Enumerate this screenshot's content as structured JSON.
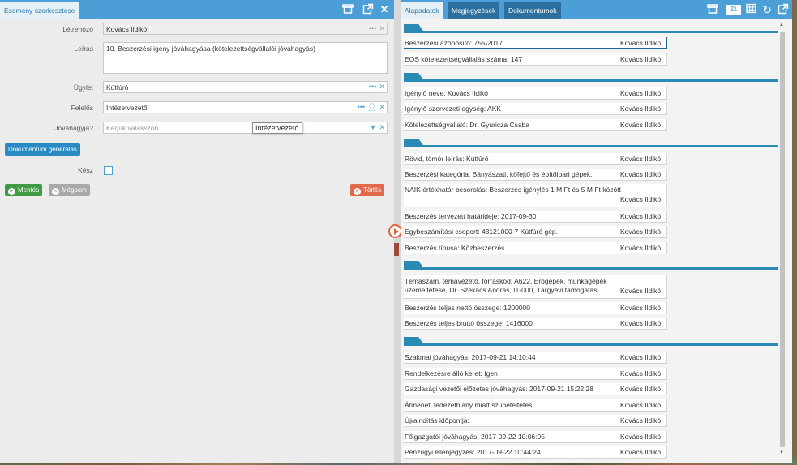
{
  "left_pane": {
    "tab_title": "Esemény szerkesztése",
    "fields": {
      "creator": {
        "label": "Létrehozó",
        "value": "Kovács Ildikó"
      },
      "description": {
        "label": "Leírás",
        "value": "10. Beszerzési igény jóváhagyása (kötelezettségvállalói jóváhagyás)"
      },
      "case": {
        "label": "Ügylet",
        "value": "Kútfúró"
      },
      "responsible": {
        "label": "Felelős",
        "value": "Intézetvezető"
      },
      "approver": {
        "label": "Jóváhagyja?",
        "placeholder": "Kérjük válasszon..."
      },
      "done": {
        "label": "Kész"
      }
    },
    "tooltip": "Intézetvezető",
    "buttons": {
      "generate": "Dokumentum generálás",
      "save": "Mentés",
      "cancel": "Mégsem",
      "delete": "Törlés"
    }
  },
  "right_pane": {
    "tabs": [
      "Alapadatok",
      "Megjegyzések",
      "Dokumentumok"
    ],
    "badge": "21",
    "owner": "Kovács Ildikó",
    "sections": [
      {
        "rows": [
          {
            "text": "Beszerzési azonosító: 755\\2017",
            "owner": "Kovács Ildikó"
          },
          {
            "text": "EOS kötelezettségvállalás száma: 147",
            "owner": "Kovács Ildikó"
          }
        ]
      },
      {
        "rows": [
          {
            "text": "Igénylő neve: Kovács Ildikó",
            "owner": "Kovács Ildikó"
          },
          {
            "text": "Igénylő szervezeti egység: AKK",
            "owner": "Kovács Ildikó"
          },
          {
            "text": "Kötelezettségvállaló: Dr. Gyuricza Csaba",
            "owner": "Kovács Ildikó"
          }
        ]
      },
      {
        "rows": [
          {
            "text": "Rövid, tömör leírás: Kútfúró",
            "owner": "Kovács Ildikó"
          },
          {
            "text": "Beszerzési kategória: Bányászati, kőfejtő és építőipari gépek.",
            "owner": "Kovács Ildikó"
          },
          {
            "text": "NAIK értékhatár besorolás: Beszerzés igénylés 1 M Ft és 5 M Ft között",
            "owner": "Kovács Ildikó"
          },
          {
            "text": "Beszerzés tervezett határideje: 2017-09-30",
            "owner": "Kovács Ildikó"
          },
          {
            "text": "Egybeszámítási csoport: 43121000-7 Kútfúró gép.",
            "owner": "Kovács Ildikó"
          },
          {
            "text": "Beszerzés típusa: Közbeszerzés",
            "owner": "Kovács Ildikó"
          }
        ]
      },
      {
        "rows": [
          {
            "text": "Témaszám, témavezető, forráskód: A622, Erőgépek, munkagépek üzemeltetése, Dr. Székács András, IT-000, Tárgyévi támogatás",
            "owner": "Kovács Ildikó"
          },
          {
            "text": "Beszerzés teljes nettó összege: 1200000",
            "owner": "Kovács Ildikó"
          },
          {
            "text": "Beszerzés teljes bruttó összege: 1416000",
            "owner": "Kovács Ildikó"
          }
        ]
      },
      {
        "rows": [
          {
            "text": "Szakmai jóváhagyás: 2017-09-21 14:10:44",
            "owner": "Kovács Ildikó"
          },
          {
            "text": "Rendelkezésre álló keret: Igen",
            "owner": "Kovács Ildikó"
          },
          {
            "text": "Gazdasági vezetői előzetes jóváhagyás: 2017-09-21 15:22:28",
            "owner": "Kovács Ildikó"
          },
          {
            "text": "Átmeneti fedezethiány miatt szüneteltetés:",
            "owner": "Kovács Ildikó"
          },
          {
            "text": "Újraindítás időpontja:",
            "owner": "Kovács Ildikó"
          },
          {
            "text": "Főigazgatói jóváhagyás: 2017-09-22 10:06:05",
            "owner": "Kovács Ildikó"
          },
          {
            "text": "Pénzügyi ellenjegyzés: 2017-09-22 10:44:24",
            "owner": "Kovács Ildikó"
          }
        ]
      }
    ]
  }
}
